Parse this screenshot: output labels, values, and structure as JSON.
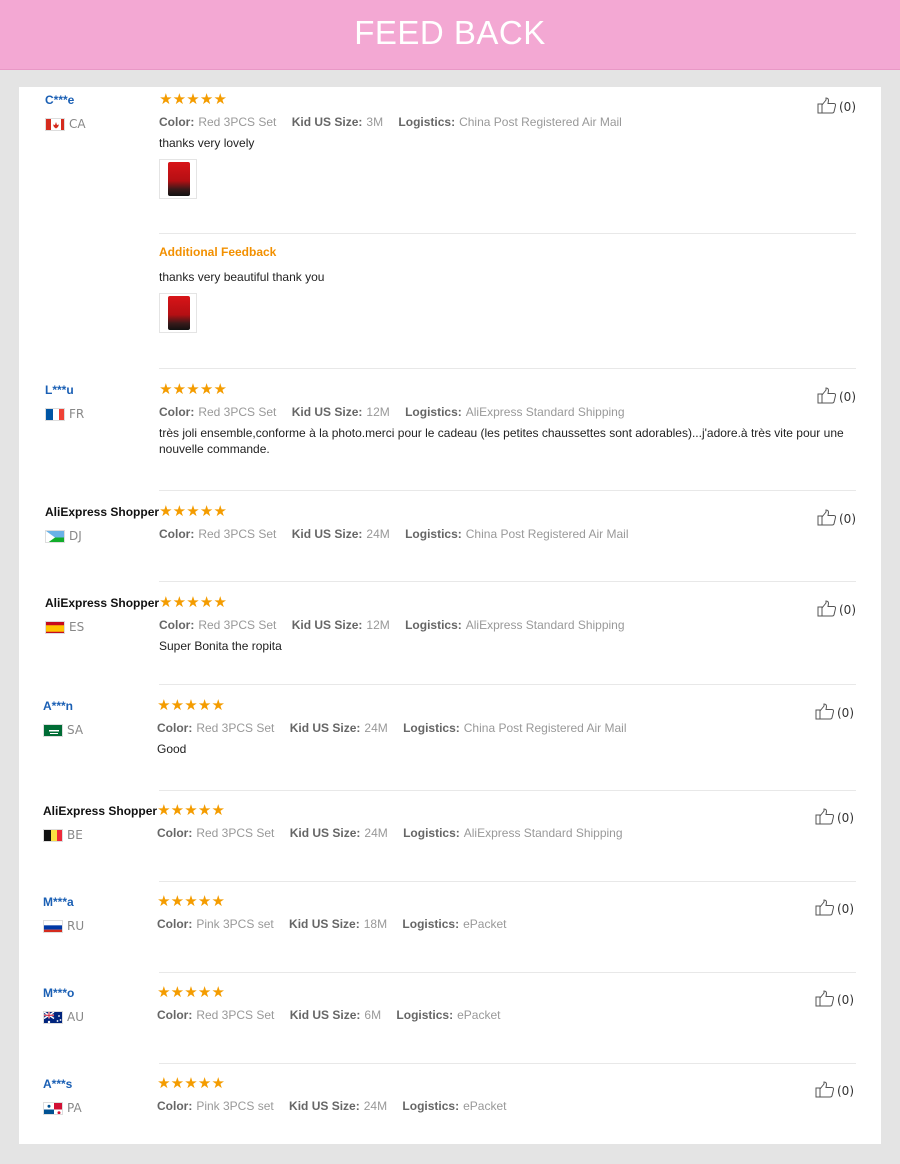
{
  "header": {
    "title": "FEED BACK"
  },
  "labels": {
    "color": "Color:",
    "size": "Kid US Size:",
    "logistics": "Logistics:",
    "additional": "Additional Feedback"
  },
  "colors": {
    "banner": "#f3a8d3",
    "stars": "#f49c00",
    "username": "#1a5fb4",
    "additional": "#f29000"
  },
  "feedbacks": [
    {
      "user": "C***e",
      "country": "CA",
      "flag": "canada-flag-icon",
      "rating": 5,
      "color": "Red 3PCS Set",
      "size": "3M",
      "logistics": "China Post Registered Air Mail",
      "comment": "thanks very lovely",
      "likes": "(0)",
      "additional_comment": "thanks very beautiful thank you"
    },
    {
      "user": "L***u",
      "country": "FR",
      "flag": "france-flag-icon",
      "rating": 5,
      "color": "Red 3PCS Set",
      "size": "12M",
      "logistics": "AliExpress Standard Shipping",
      "comment": "très joli ensemble,conforme à la photo.merci pour le cadeau (les petites chaussettes sont adorables)...j'adore.à très vite pour une nouvelle commande.",
      "likes": "(0)"
    },
    {
      "user": "AliExpress Shopper",
      "country": "DJ",
      "flag": "djibouti-flag-icon",
      "rating": 5,
      "color": "Red 3PCS Set",
      "size": "24M",
      "logistics": "China Post Registered Air Mail",
      "likes": "(0)"
    },
    {
      "user": "AliExpress Shopper",
      "country": "ES",
      "flag": "spain-flag-icon",
      "rating": 5,
      "color": "Red 3PCS Set",
      "size": "12M",
      "logistics": "AliExpress Standard Shipping",
      "comment": "Super Bonita the ropita",
      "likes": "(0)"
    },
    {
      "user": "A***n",
      "country": "SA",
      "flag": "saudi-flag-icon",
      "rating": 5,
      "color": "Red 3PCS Set",
      "size": "24M",
      "logistics": "China Post Registered Air Mail",
      "comment": "Good",
      "likes": "(0)"
    },
    {
      "user": "AliExpress Shopper",
      "country": "BE",
      "flag": "belgium-flag-icon",
      "rating": 5,
      "color": "Red 3PCS Set",
      "size": "24M",
      "logistics": "AliExpress Standard Shipping",
      "likes": "(0)"
    },
    {
      "user": "M***a",
      "country": "RU",
      "flag": "russia-flag-icon",
      "rating": 5,
      "color": "Pink 3PCS set",
      "size": "18M",
      "logistics": "ePacket",
      "likes": "(0)"
    },
    {
      "user": "M***o",
      "country": "AU",
      "flag": "australia-flag-icon",
      "rating": 5,
      "color": "Red 3PCS Set",
      "size": "6M",
      "logistics": "ePacket",
      "likes": "(0)"
    },
    {
      "user": "A***s",
      "country": "PA",
      "flag": "panama-flag-icon",
      "rating": 5,
      "color": "Pink 3PCS set",
      "size": "24M",
      "logistics": "ePacket",
      "likes": "(0)"
    }
  ]
}
